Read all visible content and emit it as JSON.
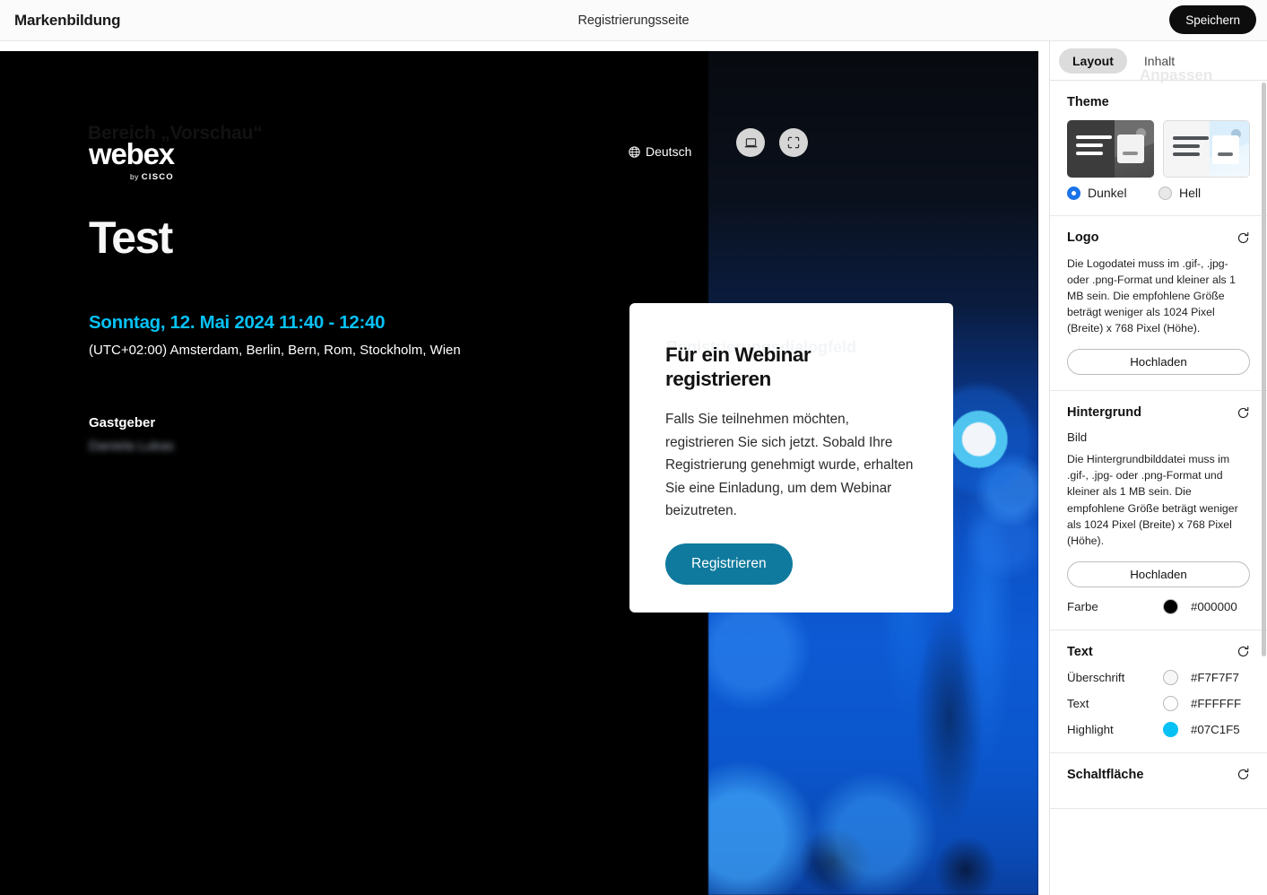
{
  "topbar": {
    "title": "Markenbildung",
    "center_title": "Registrierungsseite",
    "save_label": "Speichern"
  },
  "preview": {
    "watermark": "Bereich „Vorschau“",
    "logo_word": "webex",
    "logo_by": "by",
    "logo_cisco": "CISCO",
    "language": "Deutsch",
    "event_title": "Test",
    "event_date": "Sonntag, 12. Mai 2024 11:40 - 12:40",
    "event_timezone": "(UTC+02:00) Amsterdam, Berlin, Bern, Rom, Stockholm, Wien",
    "host_label": "Gastgeber",
    "host_name": "Daniela Lukas",
    "card": {
      "watermark": "Registrierungsdialogfeld",
      "title": "Für ein Webinar registrieren",
      "body": "Falls Sie teilnehmen möchten, registrieren Sie sich jetzt. Sobald Ihre Registrierung genehmigt wurde, erhalten Sie eine Einladung, um dem Webinar beizutreten.",
      "button_label": "Registrieren"
    }
  },
  "panel": {
    "watermark": "Anpassen",
    "tabs": [
      {
        "label": "Layout",
        "active": true
      },
      {
        "label": "Inhalt",
        "active": false
      }
    ],
    "theme": {
      "title": "Theme",
      "options": [
        {
          "label": "Dunkel",
          "selected": true
        },
        {
          "label": "Hell",
          "selected": false
        }
      ]
    },
    "logo": {
      "title": "Logo",
      "help": "Die Logodatei muss im .gif-, .jpg- oder .png-Format und kleiner als 1 MB sein. Die empfohlene Größe beträgt weniger als 1024 Pixel (Breite) x 768 Pixel (Höhe).",
      "upload_label": "Hochladen"
    },
    "background": {
      "title": "Hintergrund",
      "sub_label": "Bild",
      "help": "Die Hintergrundbilddatei muss im .gif-, .jpg- oder .png-Format und kleiner als 1 MB sein. Die empfohlene Größe beträgt weniger als 1024 Pixel (Breite) x 768 Pixel (Höhe).",
      "upload_label": "Hochladen",
      "color_label": "Farbe",
      "color_value": "#000000"
    },
    "text": {
      "title": "Text",
      "rows": [
        {
          "label": "Überschrift",
          "value": "#F7F7F7"
        },
        {
          "label": "Text",
          "value": "#FFFFFF"
        },
        {
          "label": "Highlight",
          "value": "#07C1F5"
        }
      ]
    },
    "button_section": {
      "title": "Schaltfläche"
    }
  }
}
